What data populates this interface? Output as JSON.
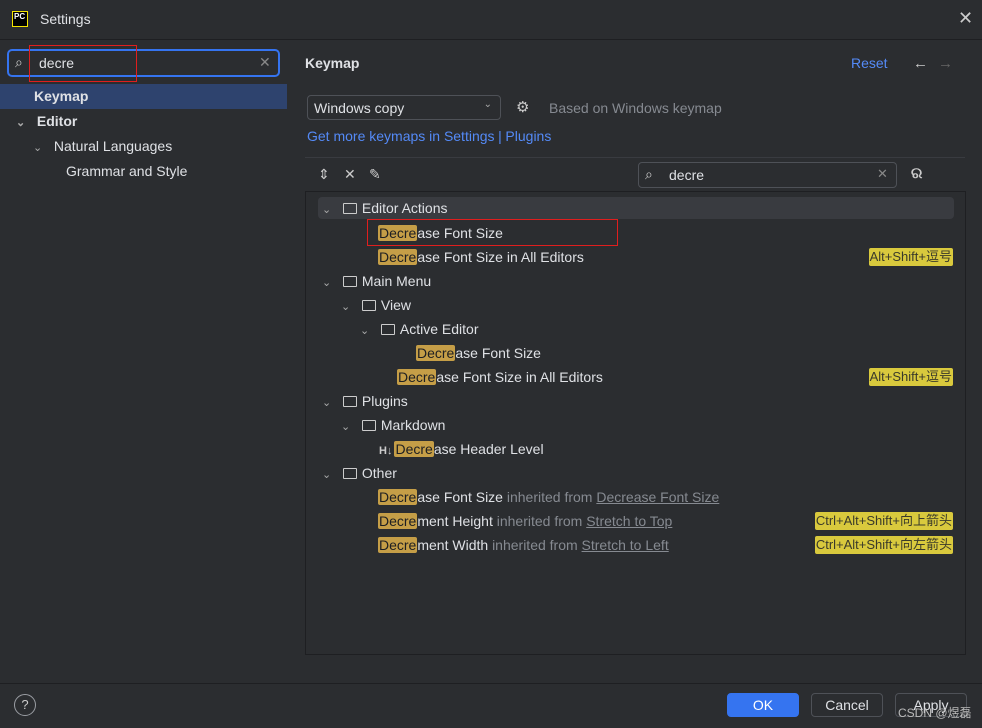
{
  "window": {
    "title": "Settings",
    "logo": "PC"
  },
  "sidebar": {
    "search_value": "decre",
    "items": [
      {
        "label": "Keymap",
        "selected": true
      },
      {
        "label": "Editor"
      },
      {
        "label": "Natural Languages"
      },
      {
        "label": "Grammar and Style"
      }
    ]
  },
  "main": {
    "title": "Keymap",
    "reset": "Reset",
    "keymap_select": "Windows copy",
    "based_on": "Based on Windows keymap",
    "link_more": "Get more keymaps in Settings",
    "link_sep": "|",
    "link_plugins": "Plugins",
    "filter_value": "decre"
  },
  "tree": [
    {
      "group": "Editor Actions"
    },
    {
      "match": "Decre",
      "rest": "ase Font Size"
    },
    {
      "match": "Decre",
      "rest": "ase Font Size in All Editors",
      "shortcut": "Alt+Shift+逗号"
    },
    {
      "group": "Main Menu"
    },
    {
      "group": "View"
    },
    {
      "group": "Active Editor"
    },
    {
      "match": "Decre",
      "rest": "ase Font Size"
    },
    {
      "match": "Decre",
      "rest": "ase Font Size in All Editors",
      "shortcut": "Alt+Shift+逗号"
    },
    {
      "group": "Plugins"
    },
    {
      "group": "Markdown"
    },
    {
      "icon_text": "H↓",
      "match": "Decre",
      "rest": "ase Header Level"
    },
    {
      "group": "Other"
    },
    {
      "match": "Decre",
      "rest": "ase Font Size",
      "inherited": "inherited from",
      "from": "Decrease Font Size"
    },
    {
      "match": "Decre",
      "rest": "ment Height",
      "inherited": "inherited from",
      "from": "Stretch to Top",
      "shortcut": "Ctrl+Alt+Shift+向上箭头"
    },
    {
      "match": "Decre",
      "rest": "ment Width",
      "inherited": "inherited from",
      "from": "Stretch to Left",
      "shortcut": "Ctrl+Alt+Shift+向左箭头"
    }
  ],
  "footer": {
    "help": "?",
    "ok": "OK",
    "cancel": "Cancel",
    "apply": "Apply",
    "watermark": "CSDN @煜磊"
  },
  "colors": {
    "accent": "#3574f0",
    "highlight": "#c59e47",
    "shortcut": "#d9c93d",
    "annotation": "#e01e1e"
  }
}
